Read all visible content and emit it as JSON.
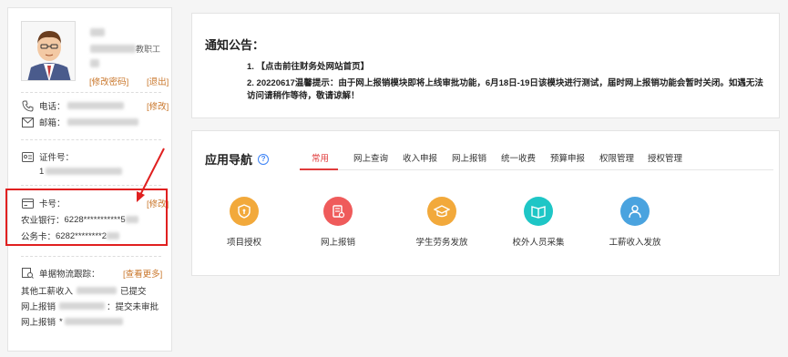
{
  "profile": {
    "role_suffix": "教职工",
    "change_password": "[修改密码]",
    "logout": "[退出]"
  },
  "contact": {
    "phone_label": "电话：",
    "email_label": "邮箱：",
    "edit": "[修改]"
  },
  "id_card": {
    "label": "证件号：",
    "value_prefix": "1"
  },
  "bank_card": {
    "label": "卡号：",
    "edit": "[修改]",
    "cards": [
      {
        "bank": "农业银行：",
        "number": "6228***********5"
      },
      {
        "bank": "公务卡：",
        "number": "6282********2"
      }
    ]
  },
  "tracking": {
    "title": "单据物流跟踪：",
    "more": "[查看更多]",
    "items": [
      {
        "type": "其他工薪收入",
        "status": "已提交"
      },
      {
        "type": "网上报销",
        "status": "：提交未审批"
      },
      {
        "type": "网上报销",
        "status": "*"
      }
    ]
  },
  "notice": {
    "title": "通知公告：",
    "lines": [
      "1. 【点击前往财务处网站首页】",
      "2. 20220617温馨提示：由于网上报销模块即将上线审批功能，6月18日-19日该模块进行测试，届时网上报销功能会暂时关闭。如遇无法",
      "访问请稍作等待，敬请谅解！"
    ]
  },
  "apps": {
    "title": "应用导航",
    "help_glyph": "?",
    "tabs": [
      "常用",
      "网上查询",
      "收入申报",
      "网上报销",
      "统一收费",
      "预算申报",
      "权限管理",
      "授权管理"
    ],
    "active_tab": "常用",
    "items": [
      {
        "label": "项目授权",
        "icon": "shield-icon",
        "color": "#f2a93b"
      },
      {
        "label": "网上报销",
        "icon": "document-icon",
        "color": "#ef5b5b"
      },
      {
        "label": "学生劳务发放",
        "icon": "graduation-cap-icon",
        "color": "#f2a93b"
      },
      {
        "label": "校外人员采集",
        "icon": "book-icon",
        "color": "#1ec6c6"
      },
      {
        "label": "工薪收入发放",
        "icon": "person-icon",
        "color": "#4aa3df"
      }
    ]
  },
  "colors": {
    "accent_link": "#c9762a",
    "active_tab": "#e03b3b",
    "highlight_box": "#e02020"
  }
}
